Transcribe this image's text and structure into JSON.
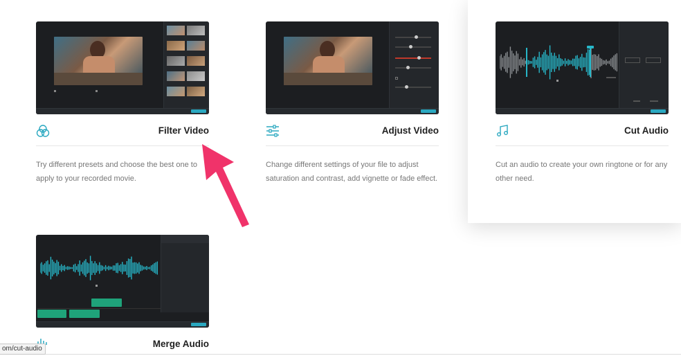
{
  "features": [
    {
      "title": "Filter Video",
      "description": "Try different presets and choose the best one to apply to your recorded movie.",
      "icon": "filter-circles-icon"
    },
    {
      "title": "Adjust Video",
      "description": "Change different settings of your file to adjust saturation and contrast, add vignette or fade effect.",
      "icon": "sliders-icon"
    },
    {
      "title": "Cut Audio",
      "description": "Cut an audio to create your own ringtone or for any other need.",
      "icon": "music-note-icon"
    },
    {
      "title": "Merge Audio",
      "description": "",
      "icon": "audio-wave-icon"
    }
  ],
  "status_url": "om/cut-audio",
  "colors": {
    "accent": "#2aa8c0",
    "annotation_arrow": "#f0336a",
    "dark_ui": "#1c1e21",
    "waveform_gray": "#8a8d91",
    "waveform_teal": "#27b7c9",
    "clip_green": "#1fa37a"
  }
}
